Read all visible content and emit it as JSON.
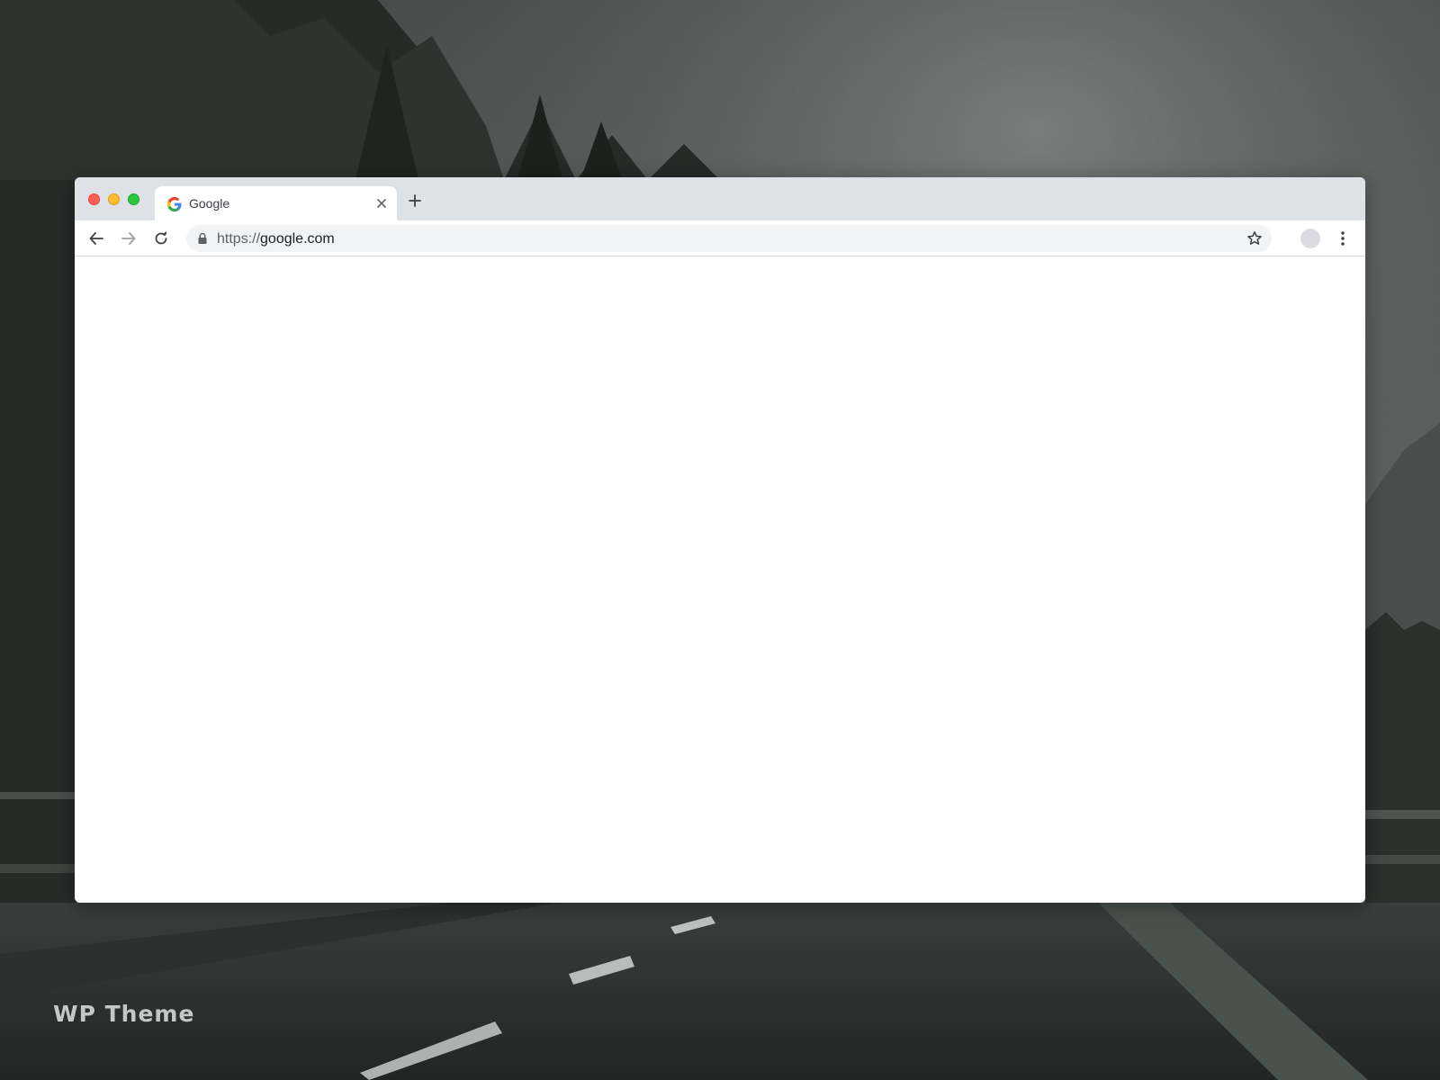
{
  "watermark": {
    "text": "WP Theme"
  },
  "browser": {
    "window_controls": [
      "close",
      "minimize",
      "maximize"
    ],
    "tab": {
      "title": "Google",
      "favicon": "google-g-icon",
      "close_icon": "close-icon"
    },
    "new_tab_icon": "plus-icon",
    "toolbar": {
      "back_icon": "arrow-left-icon",
      "forward_icon": "arrow-right-icon",
      "reload_icon": "reload-icon",
      "address": {
        "lock_icon": "lock-icon",
        "scheme": "https://",
        "host": "google.com",
        "bookmark_icon": "star-icon"
      },
      "profile_icon": "avatar",
      "menu_icon": "kebab-menu-icon"
    }
  },
  "colors": {
    "titlebar": "#dee1e6",
    "omnibox": "#f1f3f4",
    "close": "#ff5f57",
    "minimize": "#febc2e",
    "maximize": "#28c840"
  }
}
